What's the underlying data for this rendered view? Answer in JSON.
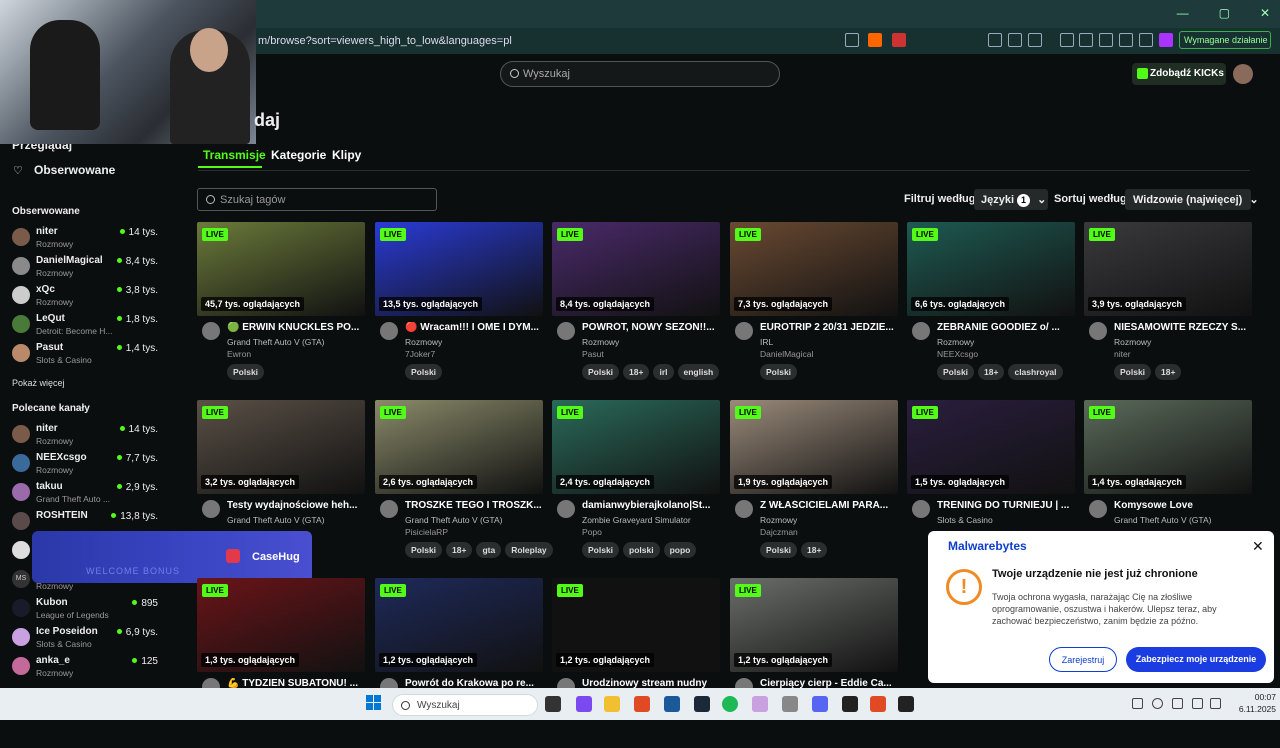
{
  "browser": {
    "url": "m/browse?sort=viewers_high_to_low&languages=pl",
    "ext_button": "Wymagane działanie"
  },
  "header": {
    "search_placeholder": "Wyszukaj",
    "kick_button": "Zdobądź KICKs"
  },
  "sidebar": {
    "nav": [
      "Przeglądaj",
      "Obserwowane"
    ],
    "followed_title": "Obserwowane",
    "followed": [
      {
        "name": "niter",
        "category": "Rozmowy",
        "viewers": "14 tys."
      },
      {
        "name": "DanielMagical",
        "category": "Rozmowy",
        "viewers": "8,4 tys."
      },
      {
        "name": "xQc",
        "category": "Rozmowy",
        "viewers": "3,8 tys."
      },
      {
        "name": "LeQut",
        "category": "Detroit: Become H...",
        "viewers": "1,8 tys."
      },
      {
        "name": "Pasut",
        "category": "Slots & Casino",
        "viewers": "1,4 tys."
      }
    ],
    "show_more": "Pokaż więcej",
    "recommended_title": "Polecane kanały",
    "recommended": [
      {
        "name": "niter",
        "category": "Rozmowy",
        "viewers": "14 tys."
      },
      {
        "name": "NEEXcsgo",
        "category": "Rozmowy",
        "viewers": "7,7 tys."
      },
      {
        "name": "takuu",
        "category": "Grand Theft Auto ...",
        "viewers": "2,9 tys."
      },
      {
        "name": "ROSHTEIN",
        "category": "",
        "viewers": "13,8 tys."
      },
      {
        "name": "",
        "category": "",
        "viewers": ""
      },
      {
        "name": "",
        "category": "Rozmowy",
        "viewers": ""
      },
      {
        "name": "Kubon",
        "category": "League of Legends",
        "viewers": "895"
      },
      {
        "name": "Ice Poseidon",
        "category": "Slots & Casino",
        "viewers": "6,9 tys."
      },
      {
        "name": "anka_e",
        "category": "Rozmowy",
        "viewers": "125"
      }
    ]
  },
  "ad": {
    "brand": "CaseHug",
    "sub": "WELCOME BONUS"
  },
  "main": {
    "title": "daj",
    "tabs": [
      "Transmisje",
      "Kategorie",
      "Klipy"
    ],
    "tag_search_placeholder": "Szukaj tagów",
    "filter_label": "Filtruj według:",
    "lang_dropdown": "Języki",
    "lang_count": "1",
    "sort_label": "Sortuj według:",
    "sort_dropdown": "Widzowie (najwięcej)"
  },
  "streams": [
    {
      "live": "LIVE",
      "viewers": "45,7 tys. oglądających",
      "title": "🟢 ERWIN KNUCKLES PO...",
      "category": "Grand Theft Auto V (GTA)",
      "streamer": "Ewron",
      "tags": [
        "Polski"
      ],
      "color": "#6b7a3a"
    },
    {
      "live": "LIVE",
      "viewers": "13,5 tys. oglądających",
      "title": "🔴 Wracam!!! I OME I DYM...",
      "category": "Rozmowy",
      "streamer": "7Joker7",
      "tags": [
        "Polski"
      ],
      "color": "#2a3bd6"
    },
    {
      "live": "LIVE",
      "viewers": "8,4 tys. oglądających",
      "title": "POWRÓT, NOWY SEZON!!...",
      "category": "Rozmowy",
      "streamer": "Pasut",
      "tags": [
        "Polski",
        "18+",
        "irl",
        "english"
      ],
      "color": "#4a2a6a"
    },
    {
      "live": "LIVE",
      "viewers": "7,3 tys. oglądających",
      "title": "EUROTRIP 2 20/31 JEDZIE...",
      "category": "IRL",
      "streamer": "DanielMagical",
      "tags": [
        "Polski"
      ],
      "color": "#6a4a32"
    },
    {
      "live": "LIVE",
      "viewers": "6,6 tys. oglądających",
      "title": "ZEBRANIE GOODIEZ o/ ...",
      "category": "Rozmowy",
      "streamer": "NEEXcsgo",
      "tags": [
        "Polski",
        "18+",
        "clashroyal"
      ],
      "color": "#1e5a52"
    },
    {
      "live": "LIVE",
      "viewers": "3,9 tys. oglądających",
      "title": "NIESAMOWITE RZECZY S...",
      "category": "Rozmowy",
      "streamer": "niter",
      "tags": [
        "Polski",
        "18+"
      ],
      "color": "#3a3a3e"
    },
    {
      "live": "LIVE",
      "viewers": "3,2 tys. oglądających",
      "title": "Testy wydajnościowe heh...",
      "category": "Grand Theft Auto V (GTA)",
      "streamer": "",
      "tags": [],
      "color": "#5a5046"
    },
    {
      "live": "LIVE",
      "viewers": "2,6 tys. oglądających",
      "title": "TROSZKE TEGO I TROSZK...",
      "category": "Grand Theft Auto V (GTA)",
      "streamer": "PisicielaRP",
      "tags": [
        "Polski",
        "18+",
        "gta",
        "Roleplay"
      ],
      "color": "#8a8a6a"
    },
    {
      "live": "LIVE",
      "viewers": "2,4 tys. oglądających",
      "title": "damianwybierajkolano|St...",
      "category": "Zombie Graveyard Simulator",
      "streamer": "Popo",
      "tags": [
        "Polski",
        "polski",
        "popo"
      ],
      "color": "#2a6a5a"
    },
    {
      "live": "LIVE",
      "viewers": "1,9 tys. oglądających",
      "title": "Z WŁAŚCICIELAMI PARA...",
      "category": "Rozmowy",
      "streamer": "Dajczman",
      "tags": [
        "Polski",
        "18+"
      ],
      "color": "#9a8a7a"
    },
    {
      "live": "LIVE",
      "viewers": "1,5 tys. oglądających",
      "title": "TRENING DO TURNIEJU | ...",
      "category": "Slots & Casino",
      "streamer": "",
      "tags": [],
      "color": "#2a1e3e"
    },
    {
      "live": "LIVE",
      "viewers": "1,4 tys. oglądających",
      "title": "Komysowe Love",
      "category": "Grand Theft Auto V (GTA)",
      "streamer": "",
      "tags": [],
      "color": "#5a6a5a"
    },
    {
      "live": "LIVE",
      "viewers": "1,3 tys. oglądających",
      "title": "💪 TYDZIEŃ SUBATONU! ...",
      "category": "",
      "streamer": "",
      "tags": [],
      "color": "#6a1418"
    },
    {
      "live": "LIVE",
      "viewers": "1,2 tys. oglądających",
      "title": "Powrót do Krakowa po re...",
      "category": "",
      "streamer": "",
      "tags": [],
      "color": "#1e2a5a"
    },
    {
      "live": "LIVE",
      "viewers": "1,2 tys. oglądających",
      "title": "Urodzinowy stream nudny",
      "category": "",
      "streamer": "",
      "tags": [],
      "color": "#111111"
    },
    {
      "live": "LIVE",
      "viewers": "1,2 tys. oglądających",
      "title": "Cierpiący cierp - Eddie Ca...",
      "category": "",
      "streamer": "",
      "tags": [],
      "color": "#6a6e6a"
    }
  ],
  "popup": {
    "brand": "Malwarebytes",
    "title": "Twoje urządzenie nie jest już chronione",
    "body": "Twoja ochrona wygasła, narażając Cię na złośliwe oprogramowanie, oszustwa i hakerów. Ulepsz teraz, aby zachować bezpieczeństwo, zanim będzie za późno.",
    "later": "Zarejestruj",
    "secure": "Zabezpiecz moje urządzenie"
  },
  "taskbar": {
    "search": "Wyszukaj",
    "time": "00:07",
    "date": "6.11.2025"
  }
}
